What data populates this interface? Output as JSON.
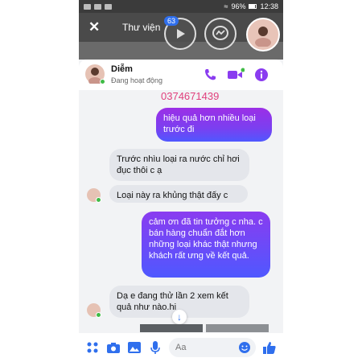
{
  "status_bar": {
    "battery": "96%",
    "time": "12:38"
  },
  "gallery": {
    "back_icon": "close-icon",
    "title": "Thư viện",
    "badge_count": "63"
  },
  "chat": {
    "contact_name": "Diễm",
    "contact_status": "Đang hoạt động",
    "overlay_text": "0374671439",
    "messages": [
      {
        "direction": "out",
        "text": "hiệu quả hơn nhiều loại trước đi"
      },
      {
        "direction": "in",
        "text": "Trước nhìu loại ra nước chỉ hơi đục thôi c ạ"
      },
      {
        "direction": "in",
        "text": "Loại này ra khủng thật đấy c"
      },
      {
        "direction": "out",
        "text": "cảm ơn đã tin tưởng c nha. c bán hàng chuẩn đắt hơn những loại khác thật nhưng khách rất ưng về kết quả."
      },
      {
        "direction": "in",
        "text": "Dạ e đang thử lần 2 xem kết quả như nào.hi"
      }
    ]
  },
  "composer": {
    "placeholder": "Aa"
  },
  "colors": {
    "accent": "#8a3cf0",
    "outgoing_gradient_end": "#4f58ff",
    "incoming_bg": "#e4e6eb",
    "overlay_text": "#e0407c",
    "online": "#3fbb46"
  }
}
